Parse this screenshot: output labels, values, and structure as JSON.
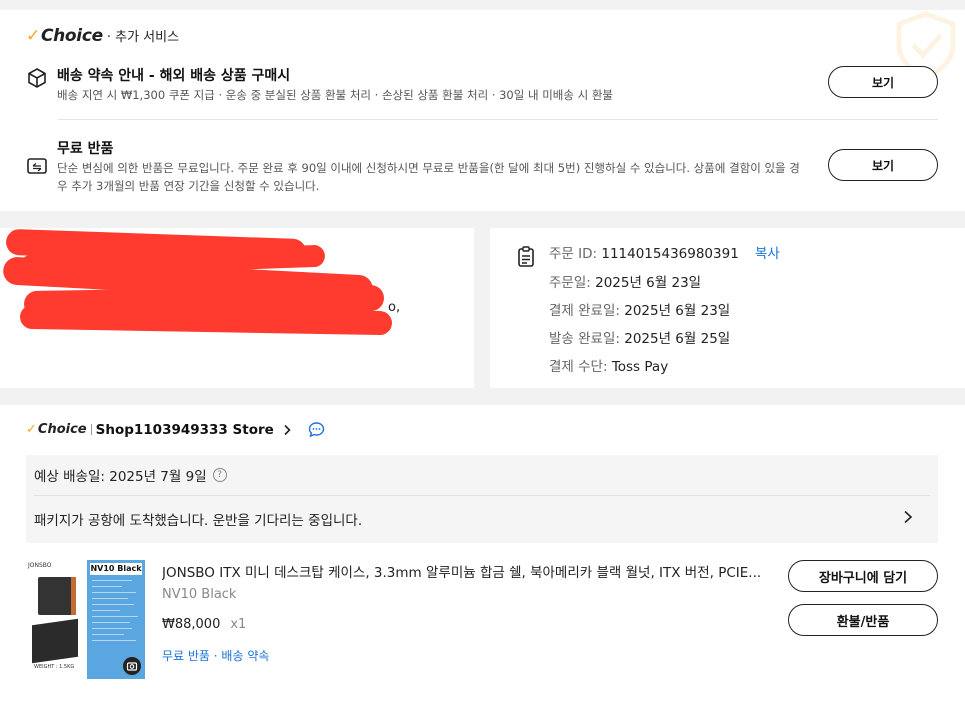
{
  "services": {
    "brand": "Choice",
    "brand_suffix": "· 추가 서비스",
    "items": [
      {
        "title": "배송 약속 안내 - 해외 배송 상품 구매시",
        "desc": "배송 지연 시 ₩1,300 쿠폰 지급 · 운송 중 분실된 상품 환불 처리 · 손상된 상품 환불 처리 · 30일 내 미배송 시 환불",
        "button": "보기",
        "icon": "box-icon"
      },
      {
        "title": "무료 반품",
        "desc_line1": "단순 변심에 의한 반품은 무료입니다. 주문 완료 후 90일 이내에 신청하시면 무료로 반품을(한 달에 최대 5번) 진행하실 수 있습니다. 상품에 결함이 있을 경",
        "desc_line2": "우 추가 3개월의 반품 연장 기간을 신청할 수 있습니다.",
        "button": "보기",
        "icon": "return-icon"
      }
    ]
  },
  "address": {
    "visible_fragment": "o,"
  },
  "order_info": {
    "order_id_label": "주문 ID: ",
    "order_id": "1114015436980391",
    "copy_label": "복사",
    "order_date_label": "주문일: ",
    "order_date": "2025년 6월 23일",
    "paid_label": "결제 완료일: ",
    "paid_date": "2025년 6월 23일",
    "shipped_label": "발송 완료일: ",
    "shipped_date": "2025년 6월 25일",
    "payment_label": "결제 수단: ",
    "payment_method": "Toss Pay"
  },
  "store": {
    "brand": "Choice",
    "name": "Shop1103949333 Store",
    "delivery_estimate": "예상 배송일: 2025년 7월 9일",
    "status": "패키지가 공항에 도착했습니다. 운반을 기다리는 중입니다.",
    "product": {
      "title": "JONSBO ITX 미니 데스크탑 케이스, 3.3mm 알루미늄 합금 쉘, 북아메리카 블랙 월넛, ITX 버전, PCIE...",
      "variant": "NV10 Black",
      "price": "₩88,000",
      "qty": "x1",
      "tags": "무료 반품 · 배송 약속",
      "thumb_label": "NV10 Black",
      "thumb_brand": "JONSBO",
      "thumb_weight": "WEIGHT : 1.5KG",
      "add_to_cart": "장바구니에 담기",
      "refund": "환불/반품"
    }
  },
  "colors": {
    "accent_check": "#f5a623",
    "link_blue": "#1a73d9",
    "redaction": "#ff3b30"
  }
}
